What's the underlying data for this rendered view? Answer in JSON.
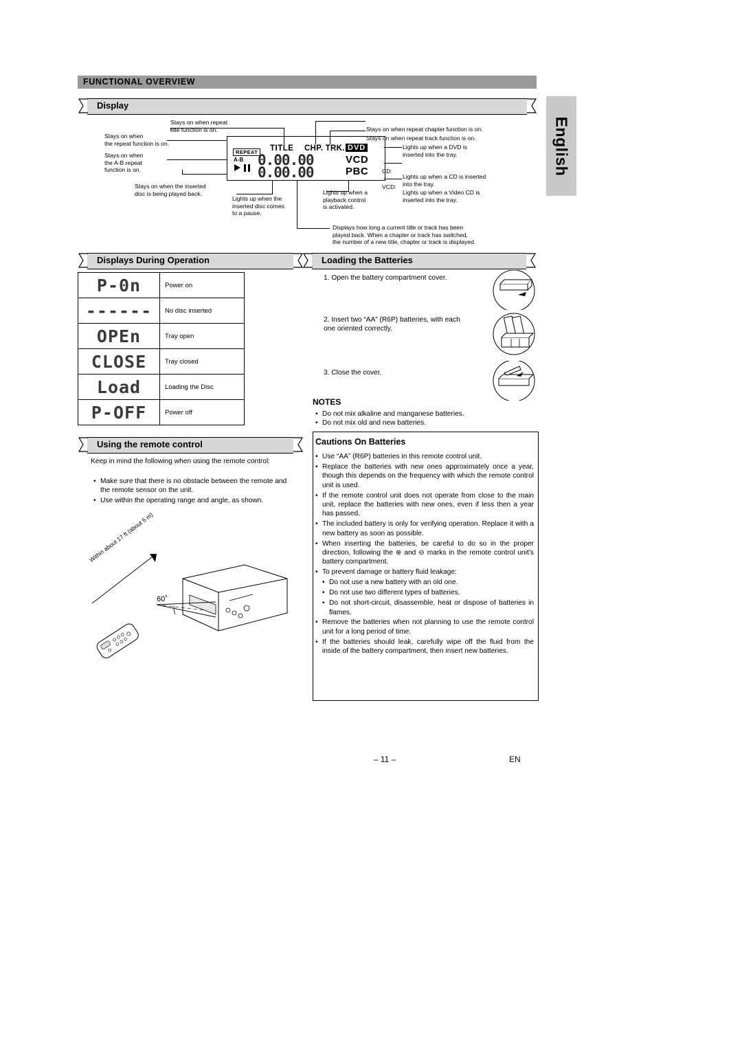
{
  "header": {
    "title": "FUNCTIONAL OVERVIEW"
  },
  "sidetab": {
    "label": "English"
  },
  "sections": {
    "display": "Display",
    "displays_during_operation": "Displays During Operation",
    "loading_batteries": "Loading the Batteries",
    "using_remote": "Using the remote control",
    "cautions": "Cautions On Batteries"
  },
  "vfd": {
    "repeat": "REPEAT",
    "ab": "A-B",
    "title": "TITLE",
    "chp_trk": "CHP. TRK.",
    "dvd": "DVD",
    "vcd": "VCD",
    "pbc": "PBC",
    "time_left": "0.00.00",
    "time_right": "0.00.00"
  },
  "callouts": {
    "repeat_title": "Stays on when repeat\ntitle function is on.",
    "repeat_chapter": "Stays on when repeat chapter function is on.",
    "repeat_track": "Stays on when repeat track function is on.",
    "repeat_on": "Stays on when\nthe repeat function is on.",
    "ab_repeat": "Stays on when\nthe A-B repeat\nfunction is on.",
    "playing_back": "Stays on when the inserted\ndisc is being played back.",
    "pause": "Lights up when the\ninserted disc comes\nto a pause.",
    "pbc": "Lights up when a\nplayback control\nis activated.",
    "dvd": "Lights up when a DVD is\ninserted into the tray.",
    "cd_label": "CD:",
    "cd": "Lights up when a CD is inserted\ninto the tray.",
    "vcd_label": "VCD:",
    "vcd": "Lights up when a Video CD is\ninserted into the tray.",
    "time": "Displays how long a current title or track has been\nplayed back. When a chapter or track has switched,\nthe number of a new title, chapter or track is displayed."
  },
  "display_table": {
    "rows": [
      {
        "glyph": "P-0n",
        "label": "Power on"
      },
      {
        "glyph": "------",
        "label": "No disc inserted"
      },
      {
        "glyph": "OPEn",
        "label": "Tray open"
      },
      {
        "glyph": "CLOSE",
        "label": "Tray closed"
      },
      {
        "glyph": "Load",
        "label": "Loading the Disc"
      },
      {
        "glyph": "P-OFF",
        "label": "Power off"
      }
    ]
  },
  "batteries": {
    "steps": [
      "1. Open the battery compartment cover.",
      "2. Insert two “AA” (R6P) batteries, with each\n    one oriented correctly.",
      "3. Close the cover."
    ],
    "notes_title": "NOTES",
    "notes": [
      "Do not mix alkaline and manganese batteries.",
      "Do not mix old and new batteries."
    ]
  },
  "remote": {
    "intro": "Keep in mind the following when using the remote control:",
    "bullets": [
      "Make sure that there is no obstacle between the remote and the remote sensor on the unit.",
      "Use within the operating range and angle, as shown."
    ],
    "range_label": "Within about 17 ft (about 5 m)",
    "angle_label": "60˚"
  },
  "cautions": [
    {
      "type": "li",
      "text": "Use “AA” (R6P) batteries in this remote control unit."
    },
    {
      "type": "li",
      "text": "Replace the batteries with new ones approximately once a year, though this depends on the frequency with which the remote control unit is used."
    },
    {
      "type": "li",
      "text": "If the remote control unit does not operate from close to the main unit, replace the batteries with new ones, even if less then a year has passed."
    },
    {
      "type": "li",
      "text": "The included battery is only for verifying operation. Replace it with a new battery as soon as possible."
    },
    {
      "type": "li",
      "text": "When inserting the batteries, be careful to do so in the proper direction, following the ⊕ and ⊖ marks in the remote control unit’s battery compartment."
    },
    {
      "type": "li",
      "text": "To prevent damage or battery fluid leakage:"
    },
    {
      "type": "sub",
      "text": "Do not use a new battery with an old one."
    },
    {
      "type": "sub",
      "text": "Do not use two different types of batteries."
    },
    {
      "type": "sub",
      "text": "Do not short-circuit, disassemble, heat or dispose of batteries in flames."
    },
    {
      "type": "li",
      "text": "Remove the batteries when not planning to use the remote control unit for a long period of time."
    },
    {
      "type": "li",
      "text": "If the batteries should leak, carefully wipe off the fluid from the inside of the battery compartment, then insert new batteries."
    }
  ],
  "footer": {
    "page": "– 11 –",
    "lang": "EN"
  }
}
